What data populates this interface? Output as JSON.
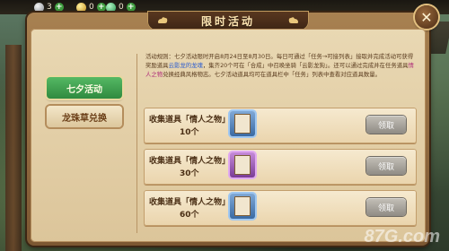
{
  "resources": [
    {
      "name": "silver",
      "icon": "silver-coin-icon",
      "value": "3",
      "plus": "+"
    },
    {
      "name": "gold",
      "icon": "gold-ingot-icon",
      "value": "0",
      "plus": "+"
    },
    {
      "name": "jade",
      "icon": "jade-icon",
      "value": "0",
      "plus": "+"
    }
  ],
  "title": "限时活动",
  "close_label": "✕",
  "tabs": [
    {
      "label": "七夕活动",
      "active": true
    },
    {
      "label": "龙珠草兑换",
      "active": false
    }
  ],
  "rules": {
    "p1": "活动规则：七夕活动限时开启8月24日至8月30日。每日可通过「任务→可接列表」接取并完成活动可获得奖励道具",
    "h1": "云影龙的龙魂",
    "p2": "，集齐20个可在「合成」中召唤坐骑「云影龙狗」。还可以通过完成并在任务道具",
    "h2": "情人之物",
    "p3": "兑换经典风格物志。七夕活动道具均可在道具栏中「任务」列表中查看对应道具数量。"
  },
  "rewards": [
    {
      "label": "收集道具「情人之物」",
      "count": "10个",
      "rarity": "blue",
      "claim": "领取"
    },
    {
      "label": "收集道具「情人之物」",
      "count": "30个",
      "rarity": "purple",
      "claim": "领取"
    },
    {
      "label": "收集道具「情人之物」",
      "count": "60个",
      "rarity": "blue",
      "claim": "领取"
    }
  ],
  "watermark": "87G.com"
}
